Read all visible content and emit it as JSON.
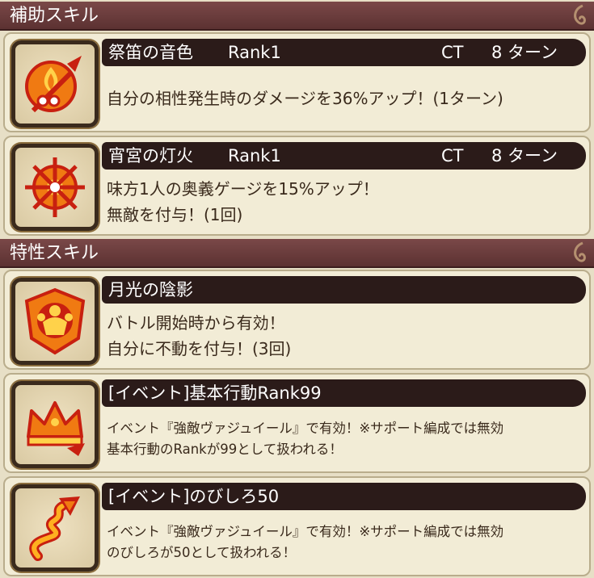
{
  "sections": {
    "support": {
      "title": "補助スキル"
    },
    "trait": {
      "title": "特性スキル"
    }
  },
  "skills": [
    {
      "name": "祭笛の音色",
      "rank": "Rank1",
      "ct_label": "CT",
      "turns": "8 ターン",
      "desc_lines": [
        "自分の相性発生時のダメージを36%アップ！(1ターン)"
      ],
      "icon": "flame-flute-icon"
    },
    {
      "name": "宵宮の灯火",
      "rank": "Rank1",
      "ct_label": "CT",
      "turns": "8 ターン",
      "desc_lines": [
        "味方1人の奥義ゲージを15%アップ！",
        "無敵を付与！(1回)"
      ],
      "icon": "sun-wheel-icon"
    },
    {
      "name": "月光の陰影",
      "desc_lines": [
        "バトル開始時から有効！",
        "自分に不動を付与！(3回)"
      ],
      "icon": "strength-shield-icon"
    },
    {
      "name": "[イベント]基本行動Rank99",
      "desc_lines": [
        "イベント『強敵ヴァジュイール』で有効！※サポート編成では無効",
        "基本行動のRankが99として扱われる！"
      ],
      "icon": "crown-icon"
    },
    {
      "name": "[イベント]のびしろ50",
      "desc_lines": [
        "イベント『強敵ヴァジュイール』で有効！※サポート編成では無効",
        "のびしろが50として扱われる！"
      ],
      "icon": "spiral-arrow-icon"
    }
  ],
  "colors": {
    "header_bg": "#6a3c3c",
    "name_bar_bg": "#2b1b19",
    "card_bg": "#f2ecd6",
    "page_bg": "#e7dfc6",
    "icon_orange": "#f07a12",
    "icon_red": "#c82010"
  }
}
